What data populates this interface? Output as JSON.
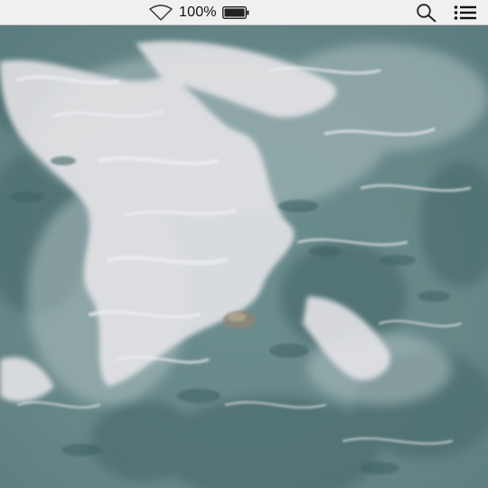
{
  "menubar": {
    "battery_percent": "100%",
    "wifi_icon": "wifi-icon",
    "battery_icon": "battery-icon",
    "search_icon": "search-icon",
    "list_icon": "list-icon"
  },
  "wallpaper": {
    "subject": "",
    "colors": {
      "water_dark": "#3f6667",
      "water_mid": "#6f8f90",
      "foam": "#e9e7ea"
    }
  }
}
